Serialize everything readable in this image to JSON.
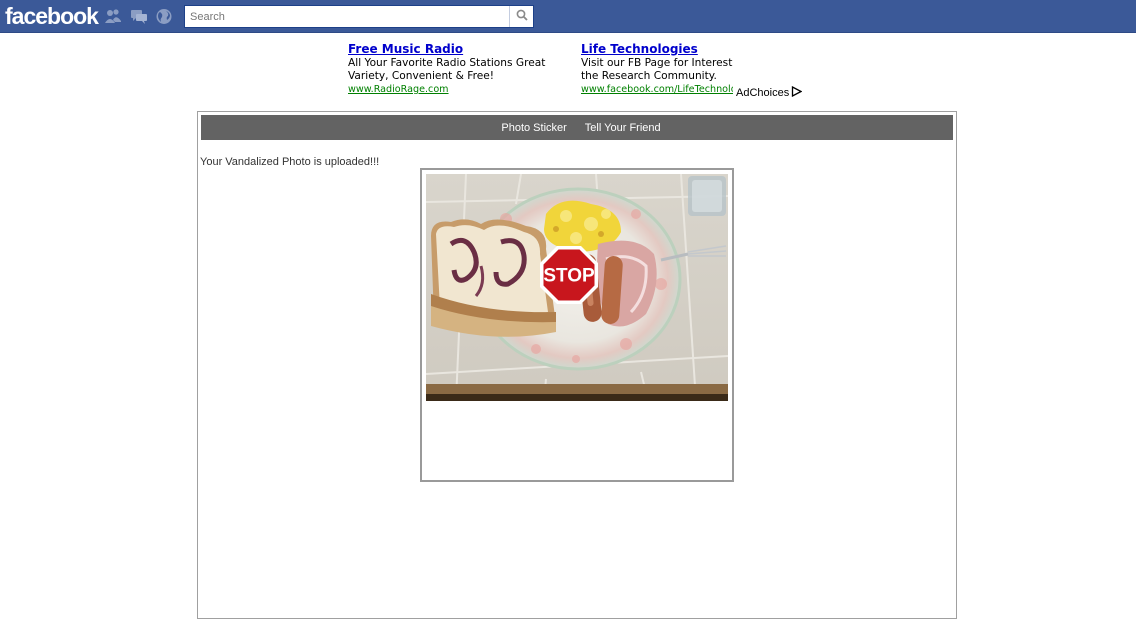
{
  "header": {
    "logo": "facebook",
    "search": {
      "placeholder": "Search",
      "value": ""
    },
    "icons": [
      "friend-requests-icon",
      "messages-icon",
      "notifications-icon",
      "search-icon"
    ]
  },
  "ads": [
    {
      "title": "Free Music Radio",
      "body": "All Your Favorite Radio Stations Great Variety, Convenient & Free!",
      "url": "www.RadioRage.com"
    },
    {
      "title": "Life Technologies",
      "body": "Visit our FB Page for Interesting Info for the Research Community.",
      "url": "www.facebook.com/LifeTechnologies"
    }
  ],
  "adchoices": "AdChoices",
  "app": {
    "nav": [
      "Photo Sticker",
      "Tell Your Friend"
    ],
    "status": "Your Vandalized Photo is uploaded!!!",
    "sticker_text": "STOP"
  },
  "colors": {
    "brand": "#3b5998",
    "nav_bg": "#636363",
    "ad_title": "#0000cc",
    "ad_url": "#008000",
    "stop_sign": "#c8161d"
  }
}
